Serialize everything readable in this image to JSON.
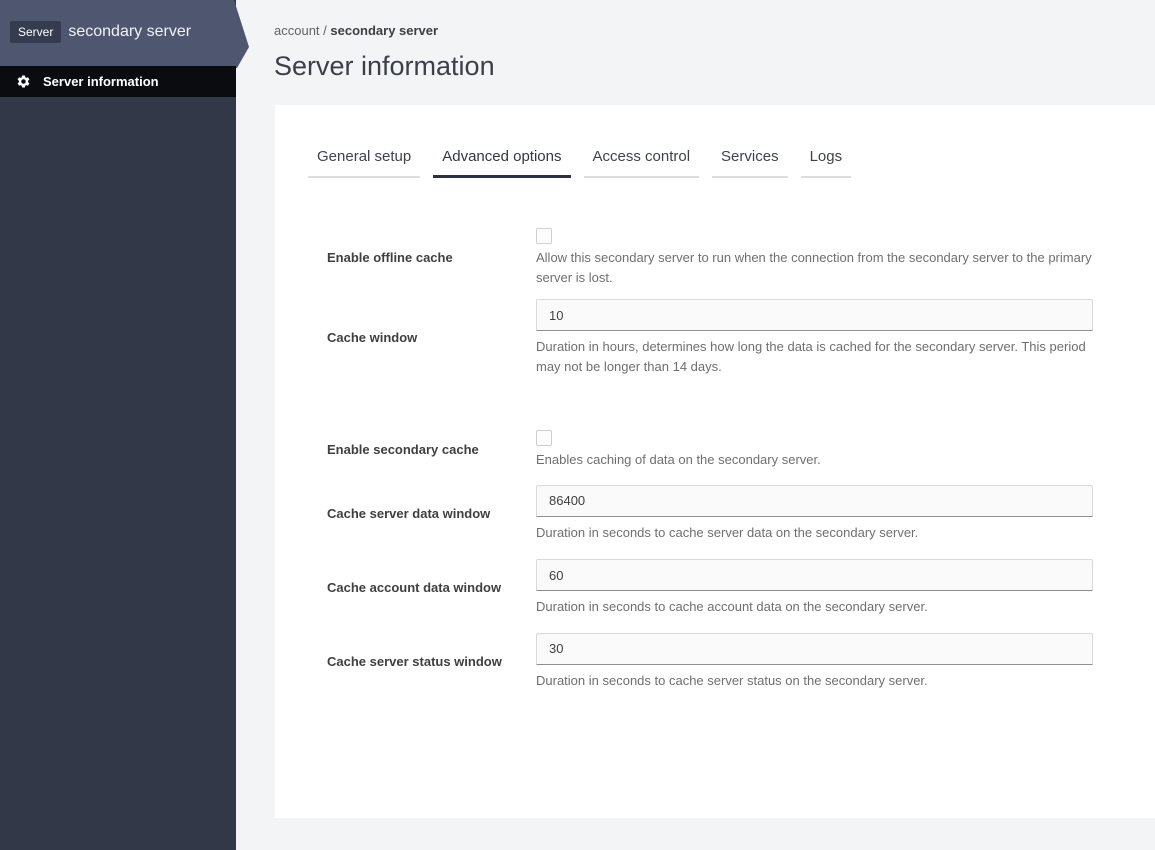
{
  "sidebar": {
    "badge": "Server",
    "title": "secondary server",
    "nav": [
      {
        "label": "Server information",
        "icon": "gear-icon"
      }
    ]
  },
  "breadcrumb": {
    "parent": "account",
    "separator": " / ",
    "current": "secondary server"
  },
  "page": {
    "title": "Server information"
  },
  "tabs": [
    {
      "label": "General setup",
      "active": false
    },
    {
      "label": "Advanced options",
      "active": true
    },
    {
      "label": "Access control",
      "active": false
    },
    {
      "label": "Services",
      "active": false
    },
    {
      "label": "Logs",
      "active": false
    }
  ],
  "form": {
    "fields": [
      {
        "type": "checkbox",
        "label": "Enable offline cache",
        "checked": false,
        "help": "Allow this secondary server to run when the connection from the secondary server to the primary server is lost."
      },
      {
        "type": "text",
        "label": "Cache window",
        "value": "10",
        "help": "Duration in hours, determines how long the data is cached for the secondary server. This period may not be longer than 14 days."
      },
      {
        "type": "checkbox",
        "label": "Enable secondary cache",
        "checked": false,
        "help": "Enables caching of data on the secondary server."
      },
      {
        "type": "text",
        "label": "Cache server data window",
        "value": "86400",
        "help": "Duration in seconds to cache server data on the secondary server."
      },
      {
        "type": "text",
        "label": "Cache account data window",
        "value": "60",
        "help": "Duration in seconds to cache account data on the secondary server."
      },
      {
        "type": "text",
        "label": "Cache server status window",
        "value": "30",
        "help": "Duration in seconds to cache server status on the secondary server."
      }
    ]
  },
  "colors": {
    "sidebar_body": "#323848",
    "sidebar_header": "#4e5670",
    "badge_bg": "#363c50",
    "nav_item_bg": "#0b0c10",
    "page_bg": "#f3f4f6",
    "card_bg": "#ffffff",
    "active_tab_underline": "#2b3143",
    "input_bg": "#fafafa",
    "help_text": "#6f6f6f"
  }
}
